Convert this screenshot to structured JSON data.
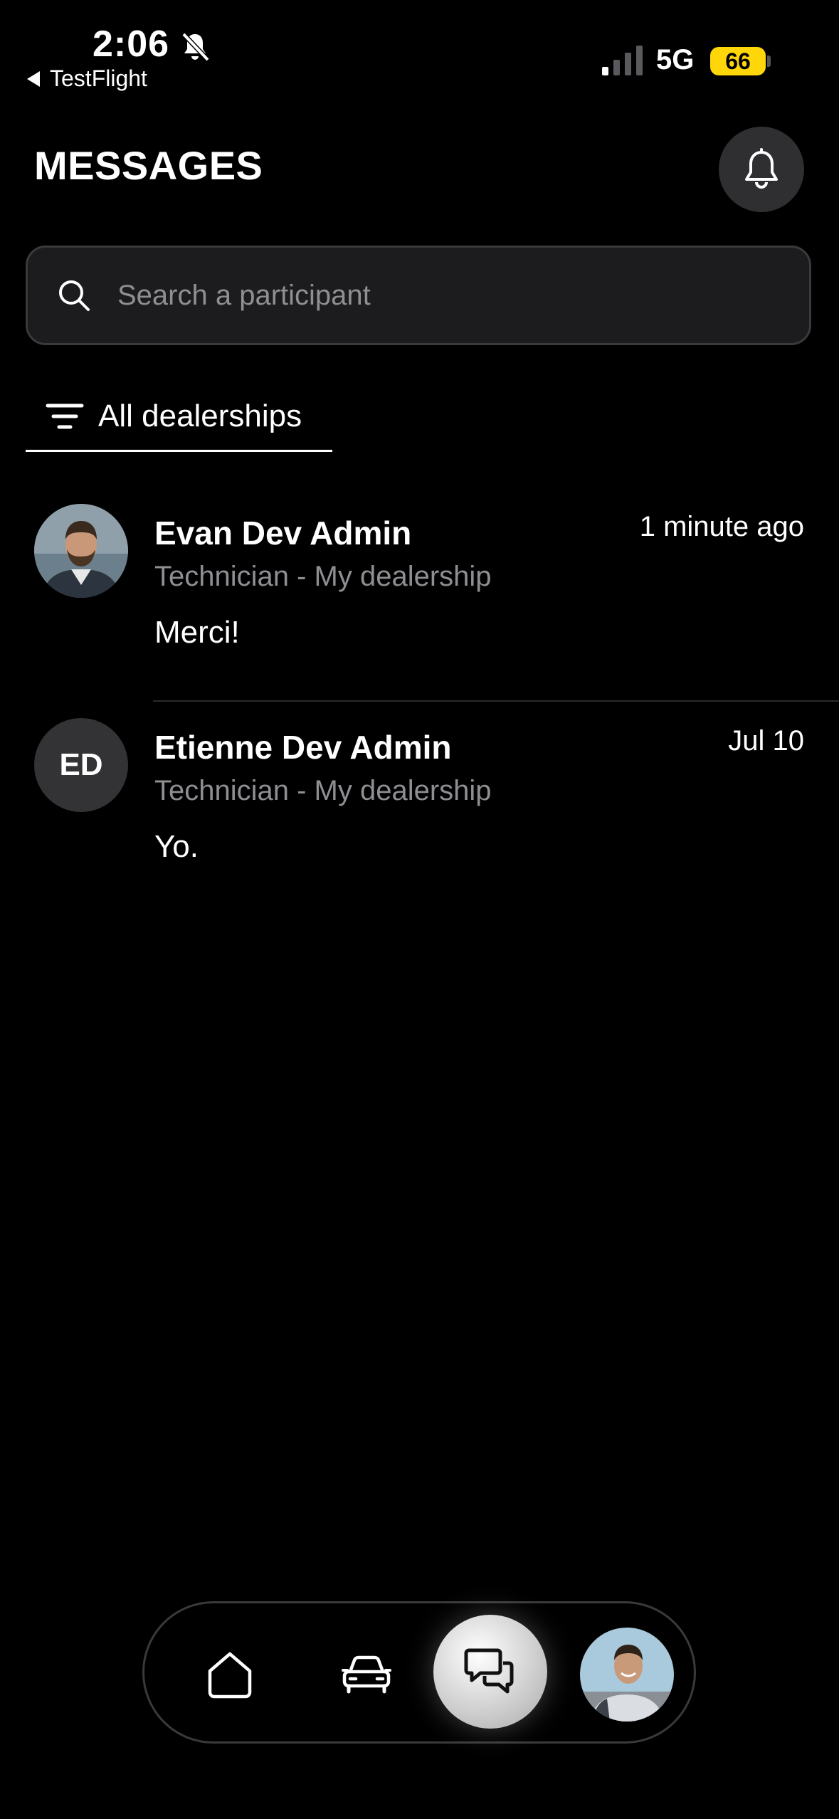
{
  "status_bar": {
    "time": "2:06",
    "back_app": "TestFlight",
    "network": "5G",
    "battery": "66"
  },
  "header": {
    "title": "MESSAGES"
  },
  "search": {
    "placeholder": "Search a participant"
  },
  "filter": {
    "label": "All dealerships"
  },
  "conversations": [
    {
      "name": "Evan Dev Admin",
      "role": "Technician - My dealership",
      "preview": "Merci!",
      "timestamp": "1 minute ago",
      "avatar": "photo"
    },
    {
      "name": "Etienne Dev Admin",
      "role": "Technician - My dealership",
      "preview": "Yo.",
      "timestamp": "Jul 10",
      "avatar_initials": "ED"
    }
  ],
  "nav": {
    "items": [
      "home-icon",
      "car-icon",
      "messages-icon",
      "profile-avatar"
    ],
    "active": "messages-icon"
  },
  "colors": {
    "background": "#000000",
    "surface": "#1c1c1e",
    "muted_text": "#8e8e93",
    "battery": "#ffd60a"
  }
}
